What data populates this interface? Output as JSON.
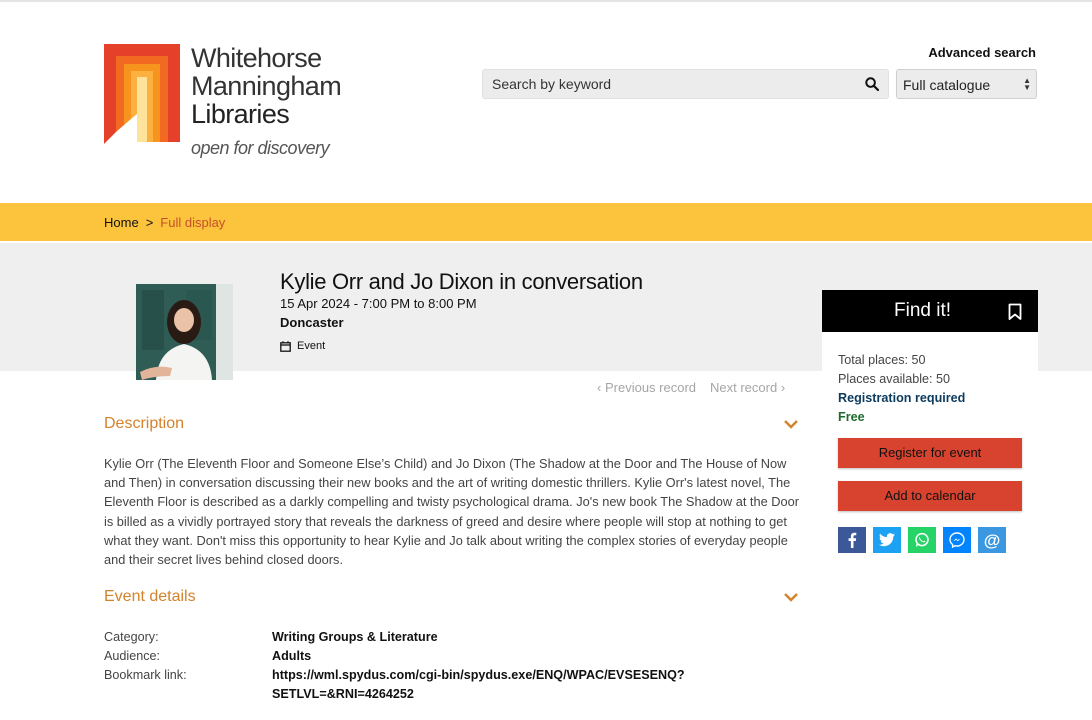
{
  "logo": {
    "line1": "Whitehorse",
    "line2": "Manningham",
    "line3": "Libraries",
    "tagline": "open for discovery"
  },
  "header": {
    "advanced_search": "Advanced search",
    "search_placeholder": "Search by keyword",
    "catalogue_selected": "Full catalogue"
  },
  "breadcrumb": {
    "home": "Home",
    "separator": ">",
    "current": "Full display"
  },
  "event": {
    "title": "Kylie Orr and Jo Dixon in conversation",
    "date": "15 Apr 2024 - 7:00 PM to 8:00 PM",
    "location": "Doncaster",
    "type": "Event"
  },
  "pager": {
    "previous": "Previous record",
    "next": "Next record"
  },
  "description": {
    "heading": "Description",
    "text": "Kylie Orr (The Eleventh Floor and Someone Else’s Child) and Jo Dixon (The Shadow at the Door and The House of Now and Then) in conversation discussing their new books and the art of writing domestic thrillers. Kylie Orr's latest novel, The Eleventh Floor is described as a darkly compelling and twisty psychological drama. Jo's new book The Shadow at the Door is billed as a vividly portrayed story that reveals the darkness of greed and desire where people will stop at nothing to get what they want. Don't miss this opportunity to hear Kylie and Jo talk about writing the complex stories of everyday people and their secret lives behind closed doors."
  },
  "event_details": {
    "heading": "Event details",
    "rows": [
      {
        "label": "Category:",
        "value": "Writing Groups & Literature"
      },
      {
        "label": "Audience:",
        "value": "Adults"
      },
      {
        "label": "Bookmark link:",
        "value": "https://wml.spydus.com/cgi-bin/spydus.exe/ENQ/WPAC/EVSESENQ?SETLVL=&RNI=4264252"
      }
    ]
  },
  "find_it": {
    "title": "Find it!",
    "total_places": "Total places: 50",
    "places_available": "Places available: 50",
    "registration": "Registration required",
    "price": "Free",
    "register_button": "Register for event",
    "calendar_button": "Add to calendar"
  },
  "share": [
    {
      "icon": "facebook-icon",
      "glyph": "f",
      "color": "#3b5998"
    },
    {
      "icon": "twitter-icon",
      "glyph": "t",
      "color": "#1da1f2"
    },
    {
      "icon": "whatsapp-icon",
      "glyph": "w",
      "color": "#25d366"
    },
    {
      "icon": "messenger-icon",
      "glyph": "m",
      "color": "#0084ff"
    },
    {
      "icon": "email-icon",
      "glyph": "@",
      "color": "#3b98e0"
    }
  ],
  "colors": {
    "crumb_bar": "#fcc33c",
    "accent_orange": "#d4822c",
    "button_red": "#d7432e"
  }
}
